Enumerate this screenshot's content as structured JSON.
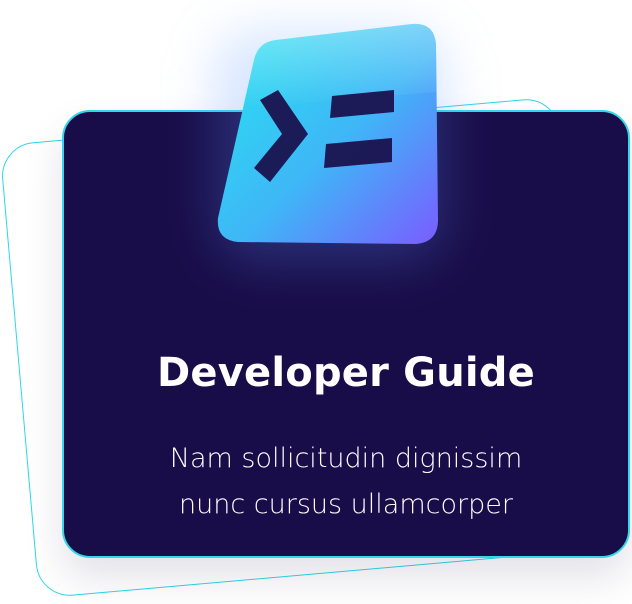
{
  "card": {
    "title": "Developer Guide",
    "subtitle_line1": "Nam sollicitudin dignissim",
    "subtitle_line2": "nunc cursus ullamcorper"
  },
  "icon": {
    "name": "terminal-icon",
    "gradient_start": "#27e6ef",
    "gradient_end": "#7a5cff"
  },
  "colors": {
    "card_background": "#190d49",
    "card_border": "#35d6ea",
    "text": "#ffffff"
  }
}
